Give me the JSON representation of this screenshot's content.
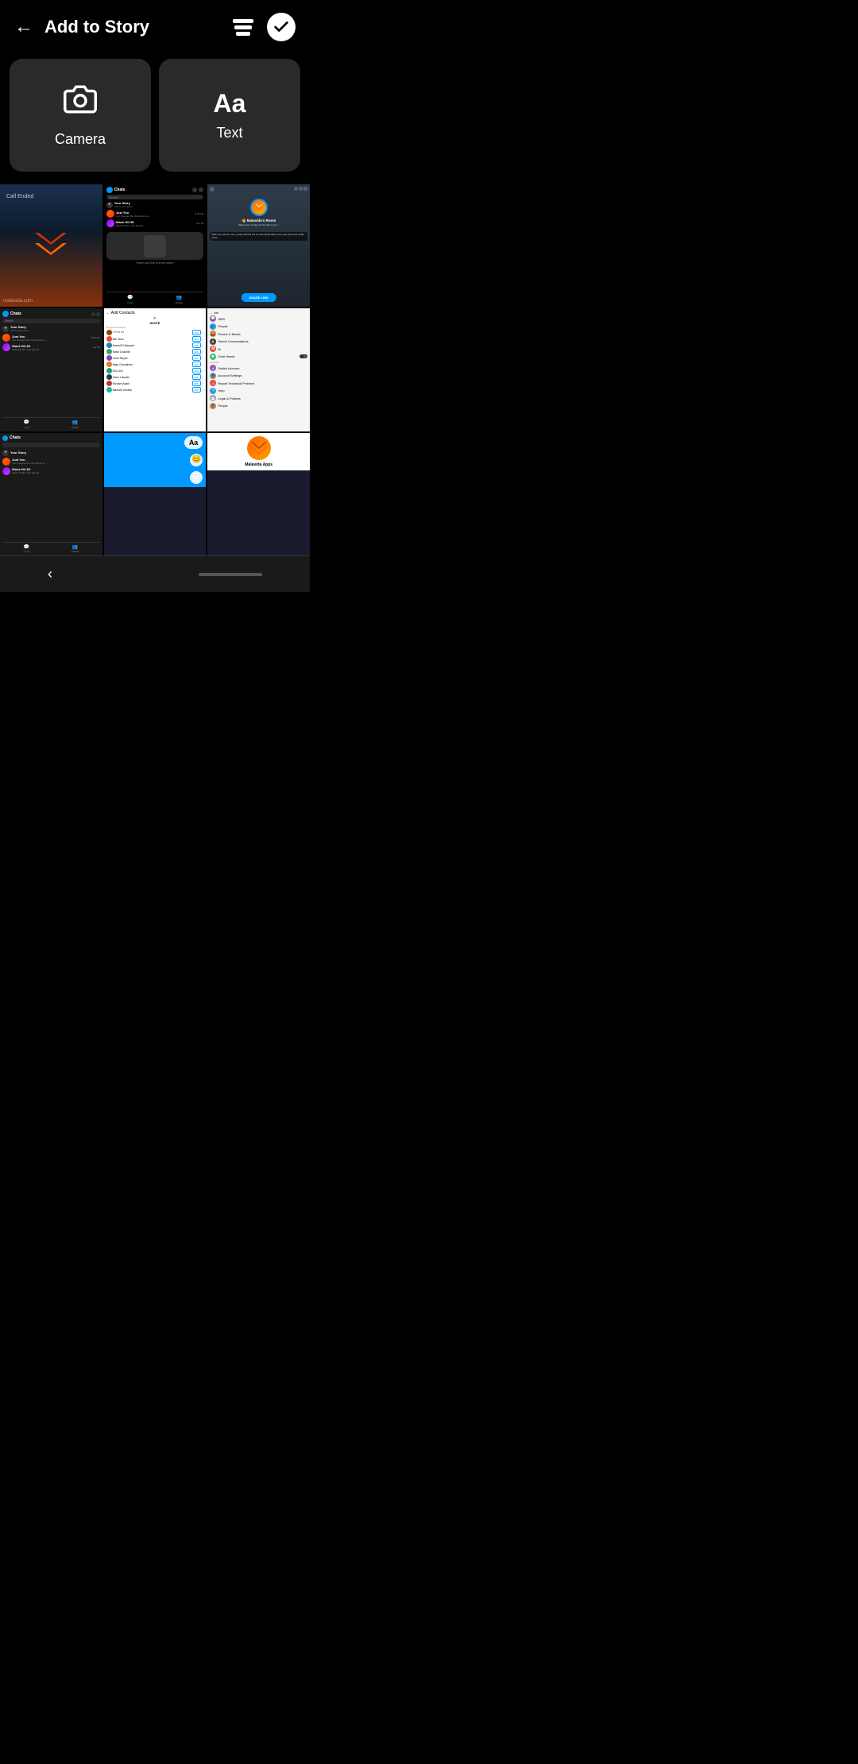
{
  "header": {
    "back_label": "←",
    "title": "Add to Story",
    "stack_icon": "stack-layers-icon",
    "check_icon": "checkmark-circle-icon"
  },
  "option_cards": [
    {
      "id": "camera",
      "icon": "camera-icon",
      "icon_symbol": "📷",
      "label": "Camera"
    },
    {
      "id": "text",
      "icon": "text-icon",
      "icon_symbol": "Aa",
      "label": "Text"
    }
  ],
  "screenshots": [
    {
      "id": "call-ended",
      "label": "Call Ended screenshot",
      "site": "malavida.com"
    },
    {
      "id": "chats-main",
      "label": "Chats main screen"
    },
    {
      "id": "malavidas-room",
      "label": "Malavida's Room"
    },
    {
      "id": "chats-small",
      "label": "Chats small view"
    },
    {
      "id": "add-contacts",
      "label": "Add Contacts screen"
    },
    {
      "id": "settings-menu",
      "label": "Settings menu"
    },
    {
      "id": "chats-dark",
      "label": "Chats dark view"
    },
    {
      "id": "compose-blue",
      "label": "Compose text blue"
    },
    {
      "id": "malavida-apps",
      "label": "Malavida Apps"
    }
  ],
  "mock_contacts": {
    "title": "Add Contacts",
    "invite_label": "INVITE",
    "suggested_label": "Suggested People",
    "people": [
      {
        "name": "এস ডি মন",
        "color": "#8B4513"
      },
      {
        "name": "Bar Tano",
        "color": "#e74c3c"
      },
      {
        "name": "Morad El Manyari",
        "color": "#2980b9"
      },
      {
        "name": "Hafid Chakhtir",
        "color": "#27ae60"
      },
      {
        "name": "Ximo Reyes",
        "color": "#8e44ad"
      },
      {
        "name": "Migu Gonçalves",
        "color": "#e67e22"
      },
      {
        "name": "Eko Ucil",
        "color": "#16a085"
      },
      {
        "name": "Osee Libwaki",
        "color": "#2c3e50"
      },
      {
        "name": "Hicham Asalii",
        "color": "#c0392b"
      },
      {
        "name": "Nøürdin Edrāwi",
        "color": "#1abc9c"
      }
    ]
  },
  "mock_settings": {
    "items": [
      {
        "label": "SMS",
        "color": "#9b59b6",
        "icon": "💬"
      },
      {
        "label": "People",
        "color": "#3498db",
        "icon": "👥"
      },
      {
        "label": "Photos & Media",
        "color": "#e67e22",
        "icon": "📷"
      },
      {
        "label": "Secret Conversations",
        "color": "#2c3e50",
        "icon": "🔒"
      },
      {
        "label": "M",
        "color": "#e74c3c",
        "icon": "M"
      },
      {
        "label": "Chat Heads",
        "color": "#2ecc71",
        "icon": "💬"
      },
      {
        "label": "Switch Account",
        "color": "#9b59b6",
        "icon": "#"
      },
      {
        "label": "Account Settings",
        "color": "#7f8c8d",
        "icon": "⚙"
      },
      {
        "label": "Report Technical Problem",
        "color": "#e74c3c",
        "icon": "⚠"
      },
      {
        "label": "Help",
        "color": "#3498db",
        "icon": "?"
      },
      {
        "label": "Legal & Policies",
        "color": "#7f8c8d",
        "icon": "📄"
      },
      {
        "label": "People",
        "color": "#e67e22",
        "icon": "👤"
      }
    ]
  },
  "chats_data": {
    "title": "Chats",
    "search_placeholder": "Search",
    "contacts": [
      {
        "name": "Just You",
        "sub": "You changed the chat theme to...",
        "time": "9:08 AM",
        "color": "#ff6b00"
      },
      {
        "name": "Stack Hit 3D",
        "sub": "Stack Hit 3D: Your friends ...",
        "time": "Apr 28",
        "color": "#9b59b6"
      }
    ],
    "nav_items": [
      "Chats",
      "People"
    ]
  },
  "bottom_nav": {
    "back_arrow": "‹",
    "home_indicator": "home-bar"
  }
}
